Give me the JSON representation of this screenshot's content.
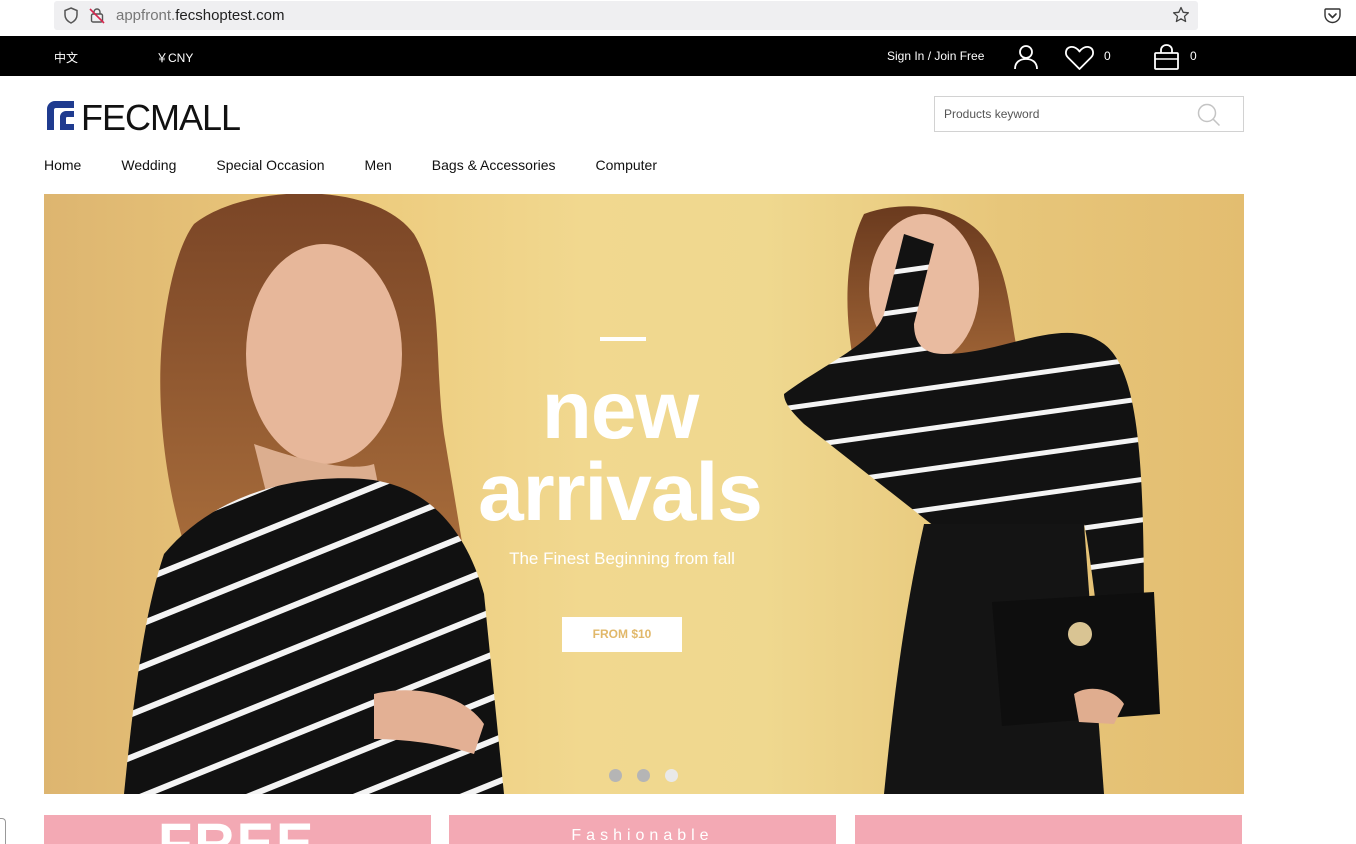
{
  "browser": {
    "url_prefix": "appfront.",
    "url_domain": "fecshoptest.com"
  },
  "topbar": {
    "language": "中文",
    "currency": "￥CNY",
    "sign_in": "Sign In / Join Free",
    "wishlist_count": "0",
    "cart_count": "0"
  },
  "header": {
    "logo_text": "FECMALL",
    "search_placeholder": "Products keyword"
  },
  "nav": {
    "items": [
      "Home",
      "Wedding",
      "Special Occasion",
      "Men",
      "Bags & Accessories",
      "Computer"
    ]
  },
  "hero": {
    "title_line1": "new",
    "title_line2": "arrivals",
    "subtitle": "The Finest Beginning from fall",
    "button_label": "FROM $10",
    "slide_count": 3,
    "active_slide": 3
  },
  "promos": {
    "free": "FREE",
    "fashionable": "Fashionable"
  },
  "colors": {
    "topbar_bg": "#000000",
    "logo_blue": "#1f3b8f",
    "promo_pink": "#f3a9b4",
    "hero_yellow": "#efd88f"
  }
}
